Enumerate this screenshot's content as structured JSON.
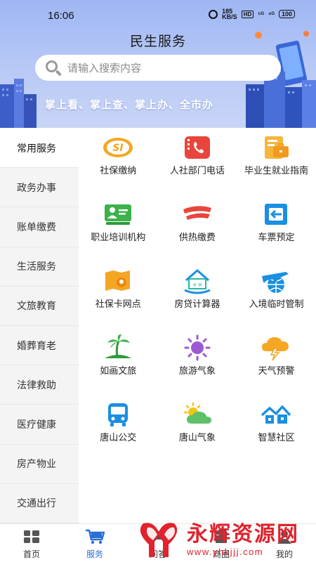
{
  "status_bar": {
    "time": "16:06",
    "speed_top": "185",
    "speed_bottom": "KB/S",
    "hd": "HD",
    "sig1": "⁵ᴳ",
    "sig2": "⁴ᴳ",
    "battery": "100"
  },
  "header": {
    "title": "民生服务",
    "slogan": "掌上看、掌上查、掌上办、全市办"
  },
  "search": {
    "placeholder": "请输入搜索内容"
  },
  "side_nav": {
    "items": [
      {
        "label": "常用服务",
        "active": true
      },
      {
        "label": "政务办事"
      },
      {
        "label": "账单缴费"
      },
      {
        "label": "生活服务"
      },
      {
        "label": "文旅教育"
      },
      {
        "label": "婚葬育老"
      },
      {
        "label": "法律救助"
      },
      {
        "label": "医疗健康"
      },
      {
        "label": "房产物业"
      },
      {
        "label": "交通出行"
      }
    ]
  },
  "services": [
    {
      "label": "社保缴纳",
      "icon": "social-security-icon",
      "logo_text": "SI"
    },
    {
      "label": "人社部门电话",
      "icon": "phone-icon"
    },
    {
      "label": "毕业生就业指南",
      "icon": "briefcase-icon"
    },
    {
      "label": "职业培训机构",
      "icon": "training-board-icon"
    },
    {
      "label": "供热缴费",
      "icon": "heating-icon"
    },
    {
      "label": "车票预定",
      "icon": "ticket-icon"
    },
    {
      "label": "社保卡网点",
      "icon": "map-pin-icon"
    },
    {
      "label": "房贷计算器",
      "icon": "house-calculator-icon"
    },
    {
      "label": "入境临时管制",
      "icon": "airplane-globe-icon"
    },
    {
      "label": "如画文旅",
      "icon": "palm-tree-icon"
    },
    {
      "label": "旅游气象",
      "icon": "sun-icon"
    },
    {
      "label": "天气预警",
      "icon": "storm-cloud-icon"
    },
    {
      "label": "唐山公交",
      "icon": "bus-icon"
    },
    {
      "label": "唐山气象",
      "icon": "cloud-sun-icon"
    },
    {
      "label": "智慧社区",
      "icon": "community-icon"
    }
  ],
  "tabs": [
    {
      "label": "首页",
      "icon": "home-grid-icon"
    },
    {
      "label": "服务",
      "icon": "cart-icon",
      "active": true
    },
    {
      "label": "问答",
      "icon": "chat-icon"
    },
    {
      "label": "商圈",
      "icon": "shop-icon"
    },
    {
      "label": "我的",
      "icon": "user-icon"
    }
  ],
  "watermark": {
    "title": "永辉资源网",
    "url": "www.yhkjjj.com"
  },
  "colors": {
    "accent": "#2a6fd6",
    "orange": "#f4a020",
    "red": "#e0232d",
    "banner": "#9eb6f4"
  }
}
